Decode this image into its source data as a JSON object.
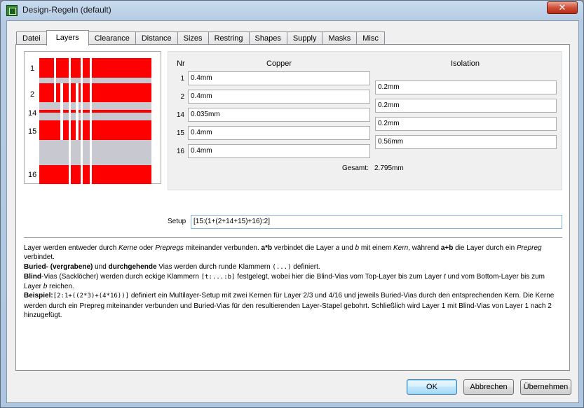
{
  "window": {
    "title": "Design-Regeln (default)",
    "close_label": "✕"
  },
  "tabs": [
    {
      "label": "Datei"
    },
    {
      "label": "Layers"
    },
    {
      "label": "Clearance"
    },
    {
      "label": "Distance"
    },
    {
      "label": "Sizes"
    },
    {
      "label": "Restring"
    },
    {
      "label": "Shapes"
    },
    {
      "label": "Supply"
    },
    {
      "label": "Masks"
    },
    {
      "label": "Misc"
    }
  ],
  "active_tab": "Layers",
  "preview": {
    "layer_labels": [
      "1",
      "2",
      "14",
      "15",
      "16"
    ]
  },
  "table": {
    "nr_header": "Nr",
    "copper_header": "Copper",
    "isolation_header": "Isolation",
    "rows": [
      {
        "nr": "1",
        "copper": "0.4mm"
      },
      {
        "nr": "2",
        "copper": "0.4mm"
      },
      {
        "nr": "14",
        "copper": "0.035mm"
      },
      {
        "nr": "15",
        "copper": "0.4mm"
      },
      {
        "nr": "16",
        "copper": "0.4mm"
      }
    ],
    "isolation": [
      "0.2mm",
      "0.2mm",
      "0.2mm",
      "0.56mm"
    ],
    "total_label": "Gesamt:",
    "total_value": "2.795mm"
  },
  "setup": {
    "label": "Setup",
    "value": "[15:(1+(2+14+15)+16):2]"
  },
  "help": {
    "p1_a": "Layer werden entweder durch ",
    "p1_b": "Kerne",
    "p1_c": " oder ",
    "p1_d": "Prepregs",
    "p1_e": " miteinander verbunden. ",
    "p1_f": "a*b",
    "p1_g": " verbindet die Layer ",
    "p1_h": "a",
    "p1_i": " und ",
    "p1_j": "b",
    "p1_k": " mit einem ",
    "p1_l": "Kern",
    "p1_m": ", während ",
    "p1_n": "a+b",
    "p1_o": " die Layer durch ein ",
    "p1_p": "Prepreg",
    "p1_q": " verbindet.",
    "p2_a": "Buried- (vergrabene)",
    "p2_b": " und ",
    "p2_c": "durchgehende",
    "p2_d": " Vias werden durch runde Klammern ",
    "p2_e": "(...)",
    "p2_f": " definiert.",
    "p3_a": "Blind",
    "p3_b": "-Vias (Sacklöcher) werden durch eckige Klammern ",
    "p3_c": "[t:...:b]",
    "p3_d": " festgelegt, wobei hier die Blind-Vias vom Top-Layer bis zum Layer ",
    "p3_e": "t",
    "p3_f": " und vom Bottom-Layer bis zum Layer ",
    "p3_g": "b",
    "p3_h": " reichen.",
    "p4_a": "Beispiel:",
    "p4_b": "[2:1+((2*3)+(4*16))]",
    "p4_c": " definiert ein Multilayer-Setup mit zwei Kernen für Layer 2/3 und 4/16 und jeweils Buried-Vias durch den entsprechenden Kern. Die Kerne werden durch ein Prepreg miteinander verbunden und Buried-Vias für den resultierenden Layer-Stapel gebohrt. Schließlich wird Layer 1 mit Blind-Vias von Layer 1 nach 2 hinzugefügt."
  },
  "buttons": {
    "ok": "OK",
    "cancel": "Abbrechen",
    "apply": "Übernehmen"
  },
  "colors": {
    "copper": "#ff0000",
    "isolation": "#c8c8d0"
  }
}
